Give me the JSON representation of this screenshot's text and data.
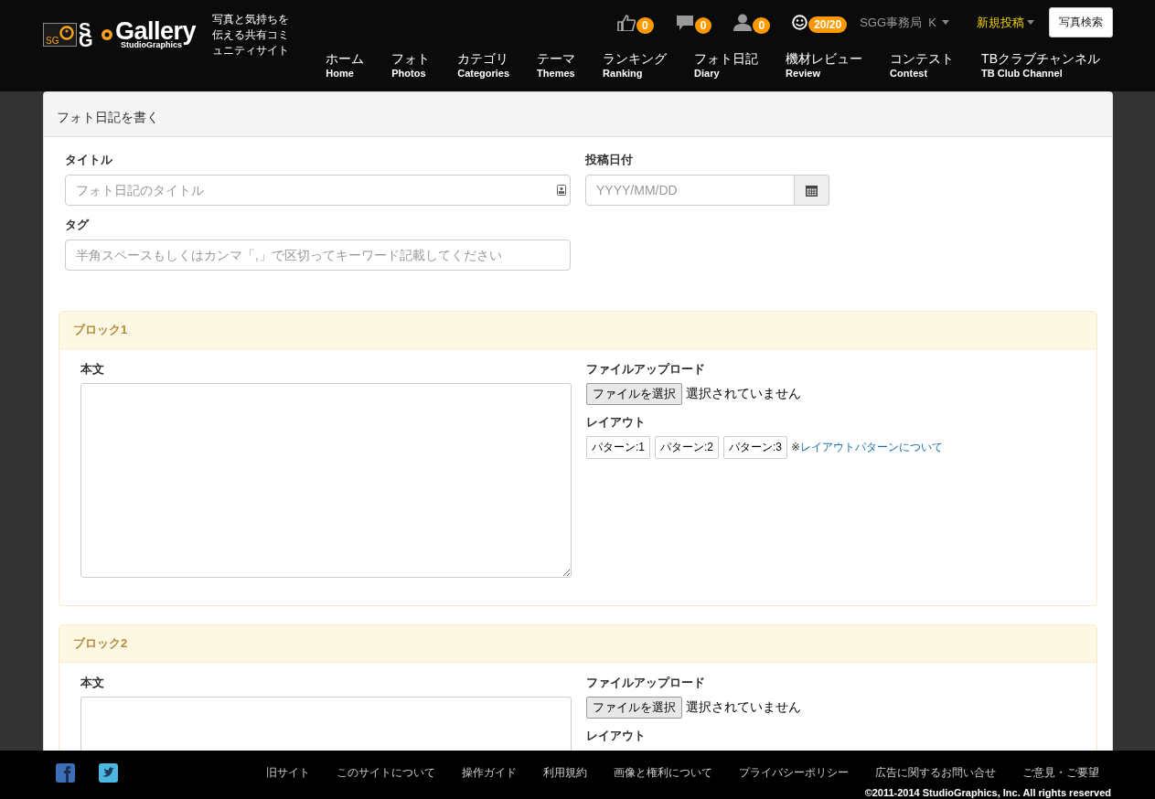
{
  "header": {
    "logo": {
      "badge": "SG",
      "mark": "SG",
      "name": "Gallery",
      "sub": "StudioGraphics"
    },
    "tagline": "写真と気持ちを伝える共有コミュニティサイト",
    "counters": [
      {
        "kind": "like",
        "count": "0"
      },
      {
        "kind": "comment",
        "count": "0"
      },
      {
        "kind": "user",
        "count": "0"
      },
      {
        "kind": "smile",
        "count": "20/20"
      }
    ],
    "account": "SGG事務局  K",
    "post_menu": "新規投稿",
    "search_button": "写真検索",
    "nav": [
      {
        "ja": "ホーム",
        "en": "Home"
      },
      {
        "ja": "フォト",
        "en": "Photos"
      },
      {
        "ja": "カテゴリ",
        "en": "Categories"
      },
      {
        "ja": "テーマ",
        "en": "Themes"
      },
      {
        "ja": "ランキング",
        "en": "Ranking"
      },
      {
        "ja": "フォト日記",
        "en": "Diary"
      },
      {
        "ja": "機材レビュー",
        "en": "Review"
      },
      {
        "ja": "コンテスト",
        "en": "Contest"
      },
      {
        "ja": "TBクラブチャンネル",
        "en": "TB Club Channel"
      }
    ]
  },
  "form": {
    "title": "フォト日記を書く",
    "title_field": {
      "label": "タイトル",
      "placeholder": "フォト日記のタイトル"
    },
    "date_field": {
      "label": "投稿日付",
      "placeholder": "YYYY/MM/DD"
    },
    "tag_field": {
      "label": "タグ",
      "placeholder": "半角スペースもしくはカンマ「,」で区切ってキーワード記載してください"
    },
    "blocks": [
      {
        "title": "ブロック1",
        "body_label": "本文",
        "upload_label": "ファイルアップロード",
        "file_button": "ファイルを選択",
        "file_status": "選択されていません",
        "layout_label": "レイアウト",
        "patterns": [
          "パターン:1",
          "パターン:2",
          "パターン:3"
        ],
        "note": "※",
        "note_link": "レイアウトパターンについて"
      },
      {
        "title": "ブロック2",
        "body_label": "本文",
        "upload_label": "ファイルアップロード",
        "file_button": "ファイルを選択",
        "file_status": "選択されていません",
        "layout_label": "レイアウト"
      }
    ]
  },
  "footer": {
    "links": [
      "旧サイト",
      "このサイトについて",
      "操作ガイド",
      "利用規約",
      "画像と権利について",
      "プライバシーポリシー",
      "広告に関するお問い合せ",
      "ご意見・ご要望"
    ],
    "copyright": "©2011-2014  StudioGraphics, Inc. All rights reserved"
  }
}
